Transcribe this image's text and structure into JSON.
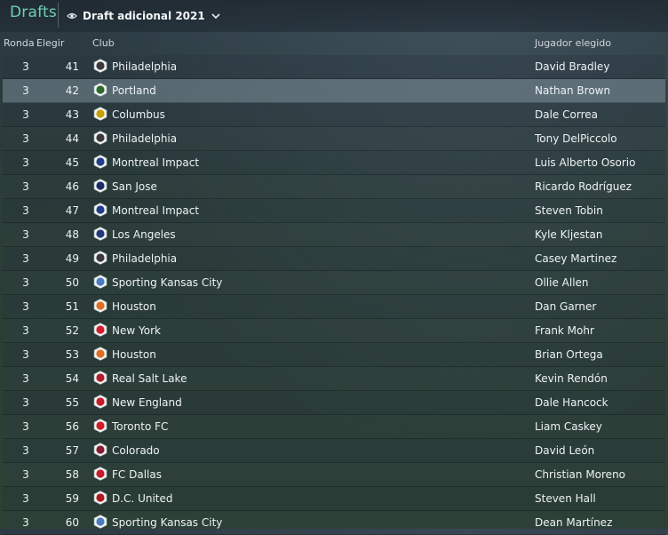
{
  "header": {
    "title": "Drafts",
    "dropdown_label": "Draft adicional 2021"
  },
  "columns": {
    "round": "Ronda",
    "pick": "Elegir",
    "club": "Club",
    "player": "Jugador elegido"
  },
  "rows": [
    {
      "round": "3",
      "pick": "41",
      "club": "Philadelphia",
      "player": "David Bradley",
      "badge_color": "#3a3a3a"
    },
    {
      "round": "3",
      "pick": "42",
      "club": "Portland",
      "player": "Nathan Brown",
      "badge_color": "#2f6b2f"
    },
    {
      "round": "3",
      "pick": "43",
      "club": "Columbus",
      "player": "Dale Correa",
      "badge_color": "#c8a000"
    },
    {
      "round": "3",
      "pick": "44",
      "club": "Philadelphia",
      "player": "Tony DelPiccolo",
      "badge_color": "#3a3a3a"
    },
    {
      "round": "3",
      "pick": "45",
      "club": "Montreal Impact",
      "player": "Luis Alberto Osorio",
      "badge_color": "#1f3f8a"
    },
    {
      "round": "3",
      "pick": "46",
      "club": "San Jose",
      "player": "Ricardo Rodríguez",
      "badge_color": "#1b2c6a"
    },
    {
      "round": "3",
      "pick": "47",
      "club": "Montreal Impact",
      "player": "Steven Tobin",
      "badge_color": "#1f3f8a"
    },
    {
      "round": "3",
      "pick": "48",
      "club": "Los Angeles",
      "player": "Kyle Kljestan",
      "badge_color": "#203a7a"
    },
    {
      "round": "3",
      "pick": "49",
      "club": "Philadelphia",
      "player": "Casey Martinez",
      "badge_color": "#3a3a3a"
    },
    {
      "round": "3",
      "pick": "50",
      "club": "Sporting Kansas City",
      "player": "Ollie Allen",
      "badge_color": "#4a7cc0"
    },
    {
      "round": "3",
      "pick": "51",
      "club": "Houston",
      "player": "Dan Garner",
      "badge_color": "#e07020"
    },
    {
      "round": "3",
      "pick": "52",
      "club": "New York",
      "player": "Frank Mohr",
      "badge_color": "#d02030"
    },
    {
      "round": "3",
      "pick": "53",
      "club": "Houston",
      "player": "Brian Ortega",
      "badge_color": "#e07020"
    },
    {
      "round": "3",
      "pick": "54",
      "club": "Real Salt Lake",
      "player": "Kevin Rendón",
      "badge_color": "#b01c2c"
    },
    {
      "round": "3",
      "pick": "55",
      "club": "New England",
      "player": "Dale Hancock",
      "badge_color": "#c81a28"
    },
    {
      "round": "3",
      "pick": "56",
      "club": "Toronto FC",
      "player": "Liam Caskey",
      "badge_color": "#d01c22"
    },
    {
      "round": "3",
      "pick": "57",
      "club": "Colorado",
      "player": "David León",
      "badge_color": "#8a1c34"
    },
    {
      "round": "3",
      "pick": "58",
      "club": "FC Dallas",
      "player": "Christian Moreno",
      "badge_color": "#c81a2a"
    },
    {
      "round": "3",
      "pick": "59",
      "club": "D.C. United",
      "player": "Steven Hall",
      "badge_color": "#b01820"
    },
    {
      "round": "3",
      "pick": "60",
      "club": "Sporting Kansas City",
      "player": "Dean Martínez",
      "badge_color": "#4a7cc0"
    }
  ],
  "highlighted_row": 1
}
